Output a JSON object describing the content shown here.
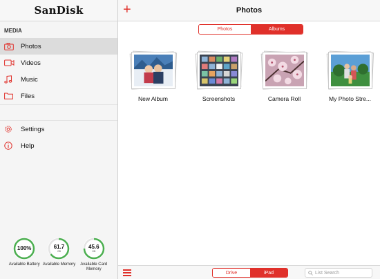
{
  "sidebar": {
    "brand": "SanDisk",
    "section": "MEDIA",
    "items": [
      {
        "label": "Photos",
        "icon": "camera-icon"
      },
      {
        "label": "Videos",
        "icon": "video-camera-icon"
      },
      {
        "label": "Music",
        "icon": "music-note-icon"
      },
      {
        "label": "Files",
        "icon": "folder-icon"
      }
    ],
    "settings": [
      {
        "label": "Settings",
        "icon": "gear-icon"
      },
      {
        "label": "Help",
        "icon": "info-icon"
      }
    ],
    "gauges": [
      {
        "value": "100%",
        "unit": "",
        "label": "Available Battery",
        "fraction": 1.0,
        "color": "#4caf50"
      },
      {
        "value": "61.7",
        "unit": "GB",
        "label": "Available Memory",
        "fraction": 0.65,
        "color": "#4caf50"
      },
      {
        "value": "45.6",
        "unit": "GB",
        "label": "Available Card Memory",
        "fraction": 0.75,
        "color": "#4caf50"
      }
    ]
  },
  "header": {
    "title": "Photos",
    "add_label": "+"
  },
  "top_segment": {
    "left": "Photos",
    "right": "Albums",
    "selected": "Albums"
  },
  "albums": [
    {
      "name": "New Album",
      "thumb": "winter-couple"
    },
    {
      "name": "Screenshots",
      "thumb": "app-grid"
    },
    {
      "name": "Camera Roll",
      "thumb": "cherry-blossom"
    },
    {
      "name": "My Photo Stre...",
      "thumb": "park-family"
    }
  ],
  "bottom": {
    "segment": {
      "left": "Drive",
      "right": "iPad",
      "selected": "iPad"
    },
    "search_placeholder": "List Search"
  },
  "colors": {
    "accent": "#e0302a",
    "gauge": "#4caf50"
  }
}
